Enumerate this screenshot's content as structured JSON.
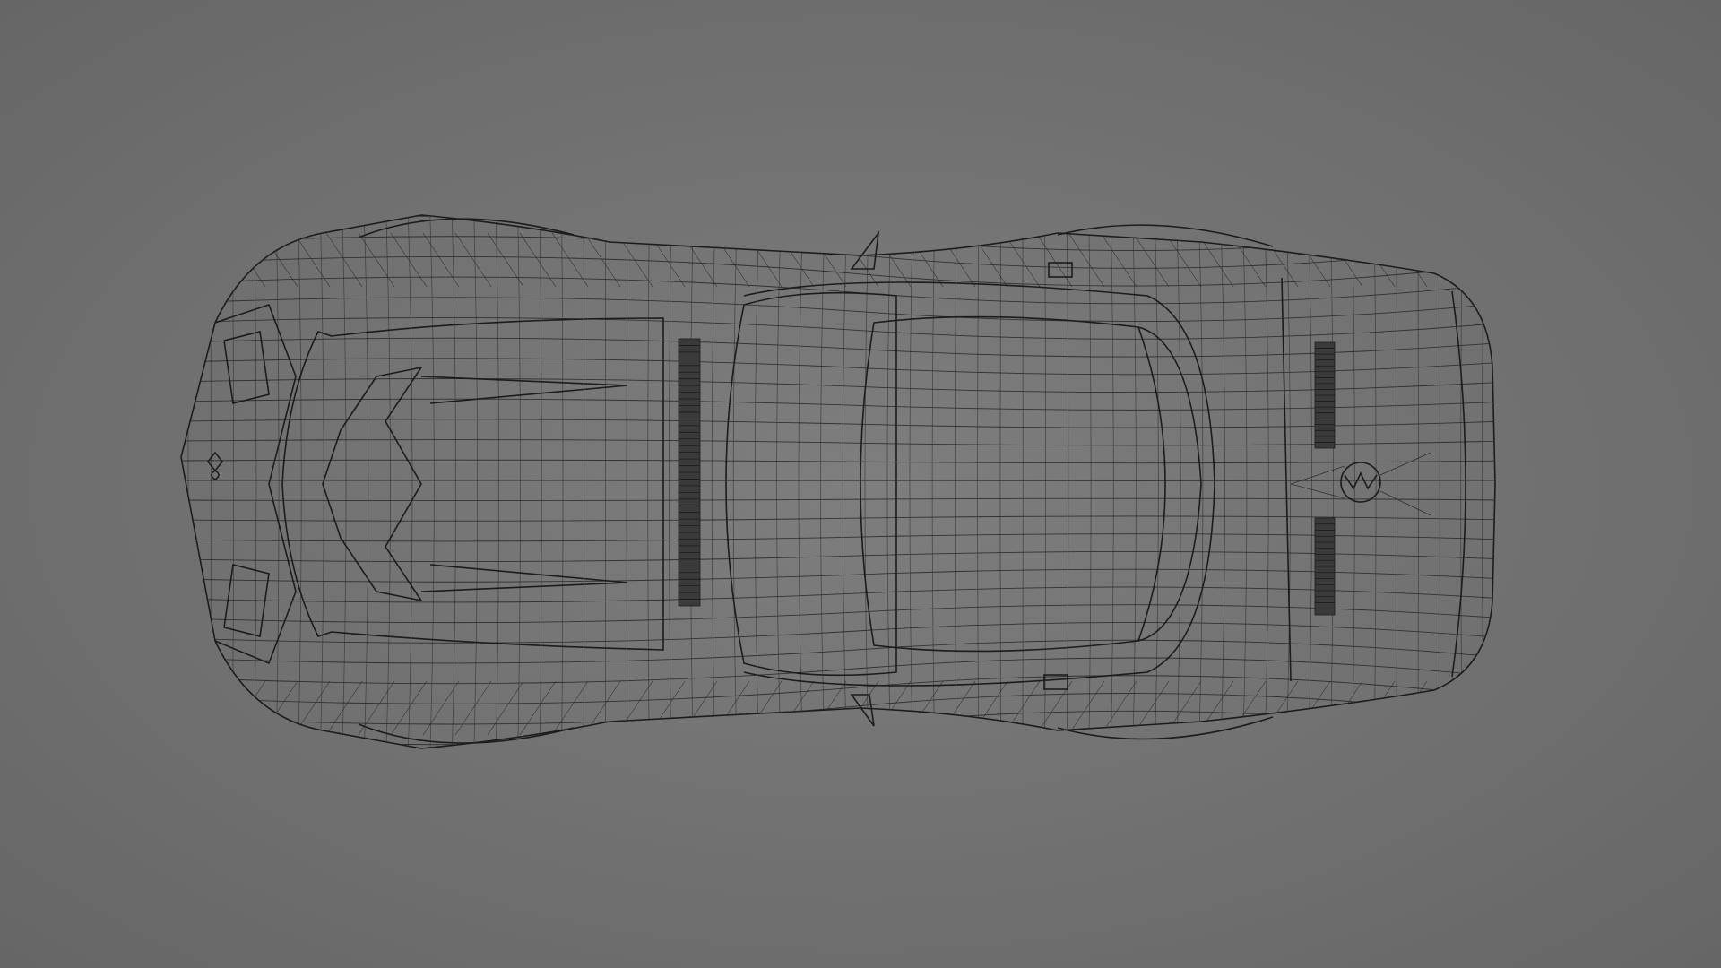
{
  "viewport": {
    "background_color": "#737373",
    "wire_color": "#1c1c1c",
    "model": "car-wireframe-top-view"
  }
}
